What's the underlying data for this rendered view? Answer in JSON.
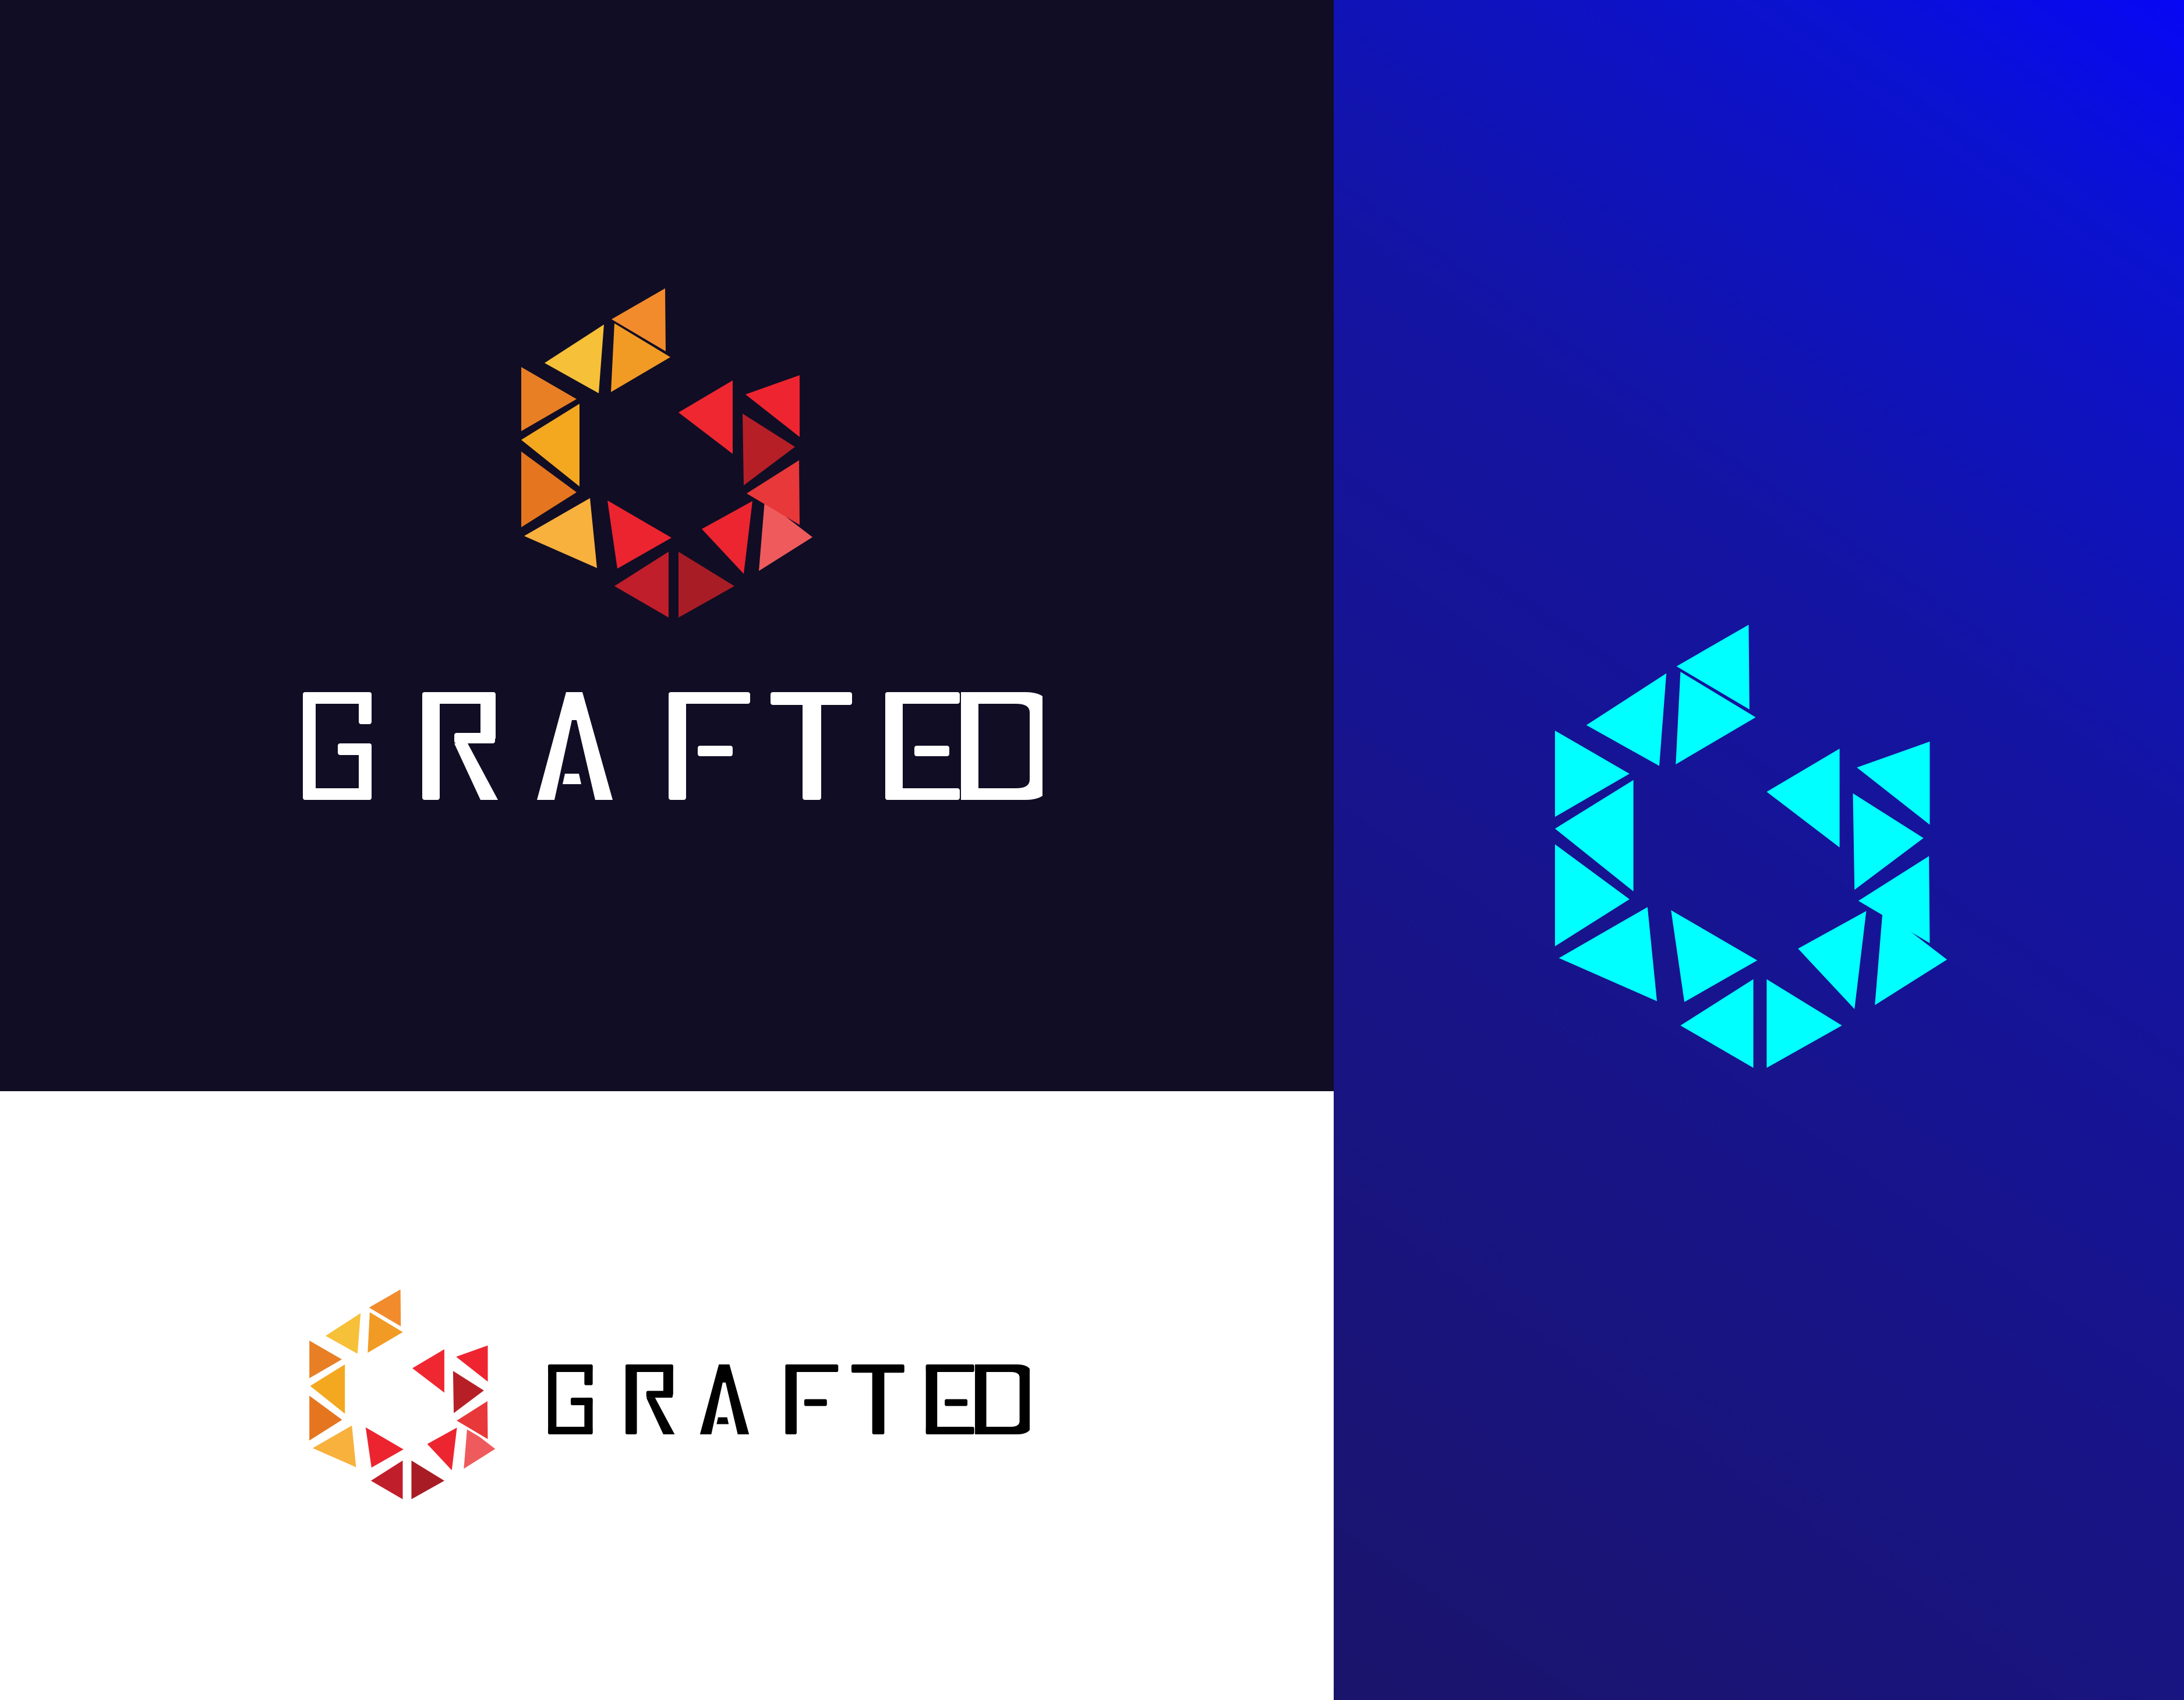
{
  "brand": {
    "name": "GRAFTED"
  },
  "panels": {
    "dark": {
      "background": "#110d24",
      "wordmark_color": "#ffffff"
    },
    "light": {
      "background": "#ffffff",
      "wordmark_color": "#000000"
    },
    "blue": {
      "gradient": [
        "#0707f5",
        "#1414a3",
        "#1b146b"
      ],
      "mark_color": "#00ffff"
    }
  },
  "mark": {
    "icon": "faceted-g-icon",
    "palette": {
      "warm": [
        "#f28b2c",
        "#f6c038",
        "#f19b24",
        "#e87f25",
        "#f4a81f",
        "#e5761f",
        "#f8b13d",
        "#ec2430",
        "#c01e2a",
        "#a81d25",
        "#ec2530",
        "#ef5b5d",
        "#e8383a",
        "#b71f27",
        "#ef2731",
        "#ee2530"
      ],
      "cool": "#00ffff"
    }
  }
}
